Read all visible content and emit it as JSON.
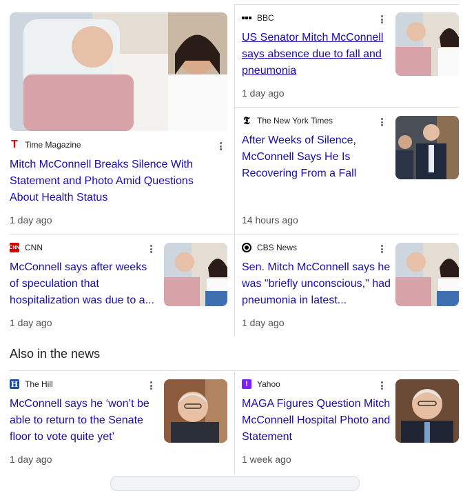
{
  "section_heading": "Also in the news",
  "articles": [
    {
      "source": "Time Magazine",
      "title": "Mitch McConnell Breaks Silence With Statement and Photo Amid Questions About Health Status",
      "age": "1 day ago",
      "logo_color": "#e00000"
    },
    {
      "source": "BBC",
      "title": "US Senator Mitch McConnell says absence due to fall and pneumonia",
      "age": "1 day ago",
      "logo_color": "#000000"
    },
    {
      "source": "The New York Times",
      "title": "After Weeks of Silence, McConnell Says He Is Recovering From a Fall",
      "age": "14 hours ago",
      "logo_color": "#000000"
    },
    {
      "source": "CNN",
      "title": "McConnell says after weeks of speculation that hospitalization was due to a...",
      "age": "1 day ago",
      "logo_color": "#cc0000"
    },
    {
      "source": "CBS News",
      "title": "Sen. Mitch McConnell says he was \"briefly unconscious,\" had pneumonia in latest...",
      "age": "1 day ago",
      "logo_color": "#000000"
    },
    {
      "source": "The Hill",
      "title": "McConnell says he ‘won’t be able to return to the Senate floor to vote quite yet’",
      "age": "1 day ago",
      "logo_color": "#1a4ea1"
    },
    {
      "source": "Yahoo",
      "title": "MAGA Figures Question Mitch McConnell Hospital Photo and Statement",
      "age": "1 week ago",
      "logo_color": "#7e1fff"
    }
  ],
  "colors": {
    "link": "#1a0dab",
    "meta": "#4d5156",
    "divider": "#dadce0"
  }
}
